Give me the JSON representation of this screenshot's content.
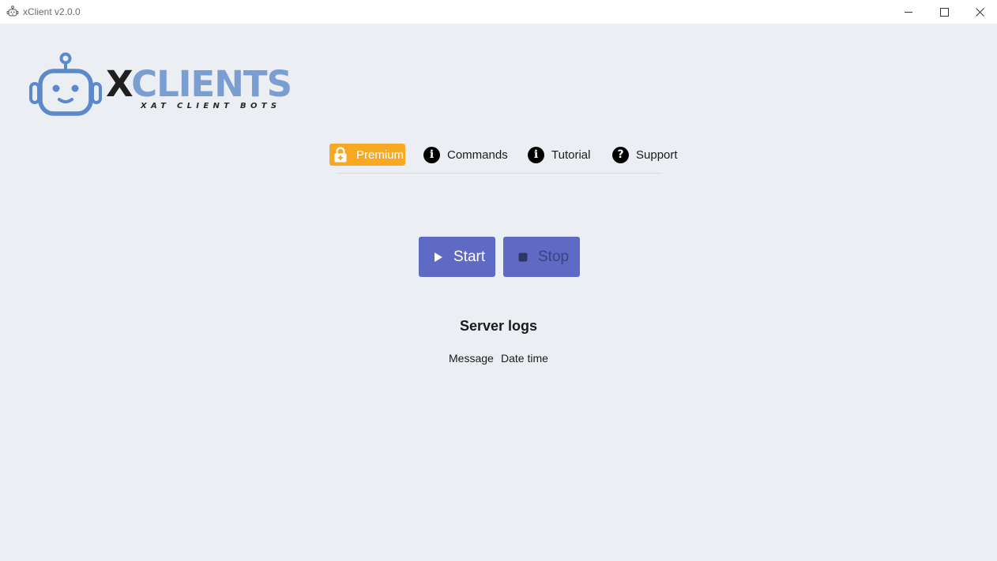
{
  "window": {
    "title": "xClient v2.0.0",
    "icon": "robot-icon",
    "controls": [
      "minimize-icon",
      "maximize-icon",
      "close-icon"
    ]
  },
  "logo": {
    "wordmark_x": "X",
    "wordmark_rest": "CLIENTS",
    "tagline": "XAT CLIENT BOTS",
    "colors": {
      "wordmark_x": "#1f1f1f",
      "wordmark_rest": "#7b9ed2",
      "robot": "#5b89c9"
    }
  },
  "nav": {
    "items": [
      {
        "label": "Premium",
        "icon": "lock-icon",
        "active": true
      },
      {
        "label": "Commands",
        "icon": "info-icon"
      },
      {
        "label": "Tutorial",
        "icon": "info-icon"
      },
      {
        "label": "Support",
        "icon": "help-icon"
      }
    ],
    "active_color": "#f7a924"
  },
  "actions": {
    "start_label": "Start",
    "stop_label": "Stop",
    "button_color": "#5e6ac4"
  },
  "logs": {
    "title": "Server logs",
    "columns": [
      "Message",
      "Date time"
    ],
    "rows": []
  }
}
